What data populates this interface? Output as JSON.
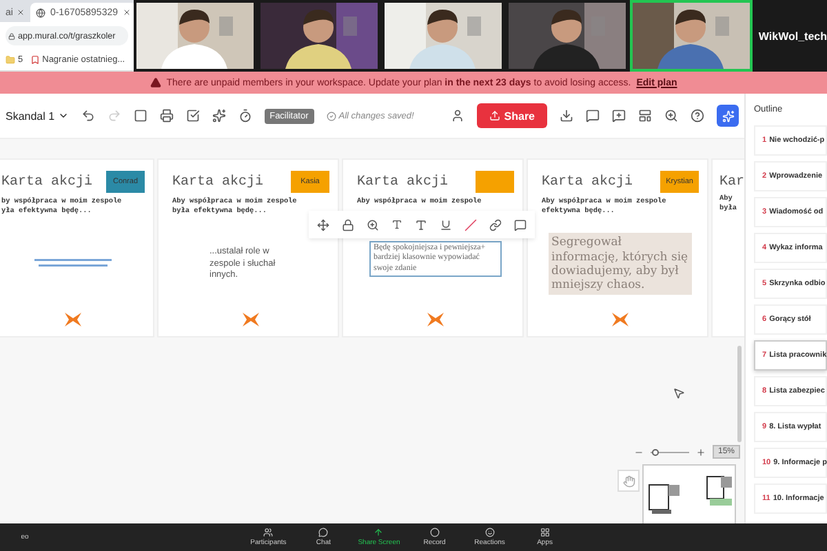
{
  "browser": {
    "tabs": [
      {
        "label": "ai",
        "selected": false
      },
      {
        "label": "0-16705895329",
        "selected": true
      }
    ],
    "url": "app.mural.co/t/graszkoler",
    "bookmarks": [
      {
        "label": "5",
        "kind": "folder"
      },
      {
        "label": "Nagranie ostatnieg...",
        "kind": "page"
      }
    ]
  },
  "video_tiles": [
    {
      "active": false
    },
    {
      "active": false
    },
    {
      "active": false
    },
    {
      "active": false
    },
    {
      "active": true
    }
  ],
  "name_tile": "WikWol_tech",
  "banner": {
    "text": "There are unpaid members in your workspace. Update your plan **in the next 23 days** to avoid losing access.",
    "link": "Edit plan"
  },
  "toolbar": {
    "board_name": "Skandal 1",
    "facilitator": "Facilitator",
    "save_status": "All changes saved!",
    "share": "Share"
  },
  "cards": [
    {
      "title": "Karta akcji",
      "tag": {
        "label": "Conrad",
        "color": "#2b8aa6"
      },
      "prompt": "by współpraca w moim zespole\nyła efektywna będę...",
      "note": {
        "kind": "scribble"
      }
    },
    {
      "title": "Karta akcji",
      "tag": {
        "label": "Kasia",
        "color": "#f5a100"
      },
      "prompt": "Aby współpraca w moim zespole\nbyła efektywna będę...",
      "note": {
        "kind": "plain",
        "text": "...ustalał role w zespole i słuchał innych."
      }
    },
    {
      "title": "Karta akcji",
      "tag": {
        "color": "#f5a100"
      },
      "prompt": "Aby współpraca w moim zespole",
      "note": {
        "kind": "selected",
        "text": "Będę spokojniejsza i pewniejsza+ bardziej klasownie wypowiadać swoje zdanie"
      }
    },
    {
      "title": "Karta akcji",
      "tag": {
        "label": "Krystian",
        "color": "#f5a100"
      },
      "prompt": "Aby współpraca w moim zespole\nefektywna będę...",
      "note": {
        "kind": "highlight",
        "text": "Segregował informację, których się dowiadujemy, aby był mniejszy chaos."
      }
    },
    {
      "title": "Kar",
      "prompt": "Aby\nbyła"
    }
  ],
  "outline": {
    "title": "Outline",
    "items": [
      {
        "number": "1",
        "label": "Nie wchodzić-p",
        "selected": false
      },
      {
        "number": "2",
        "label": "Wprowadzenie",
        "selected": false
      },
      {
        "number": "3",
        "label": "Wiadomość od",
        "selected": false
      },
      {
        "number": "4",
        "label": "Wykaz informa",
        "selected": false
      },
      {
        "number": "5",
        "label": "Skrzynka odbio",
        "selected": false
      },
      {
        "number": "6",
        "label": "Gorący stół",
        "selected": false
      },
      {
        "number": "7",
        "label": "Lista pracownik",
        "selected": true
      },
      {
        "number": "8",
        "label": "Lista zabezpiec",
        "selected": false
      },
      {
        "number": "9",
        "label": "8. Lista wypłat",
        "selected": false
      },
      {
        "number": "10",
        "label": "9. Informacje p",
        "selected": false
      },
      {
        "number": "11",
        "label": "10. Informacje",
        "selected": false
      }
    ]
  },
  "zoom_slider": {
    "level": 0.1
  },
  "zoom_level": "15%",
  "meeting_bar": [
    {
      "label": "eo",
      "kind": "video"
    },
    {
      "label": "Participants",
      "kind": "participants"
    },
    {
      "label": "Chat",
      "kind": "chat"
    },
    {
      "label": "Share Screen",
      "kind": "share"
    },
    {
      "label": "Record",
      "kind": "record"
    },
    {
      "label": "Reactions",
      "kind": "reactions"
    },
    {
      "label": "Apps",
      "kind": "apps"
    }
  ]
}
